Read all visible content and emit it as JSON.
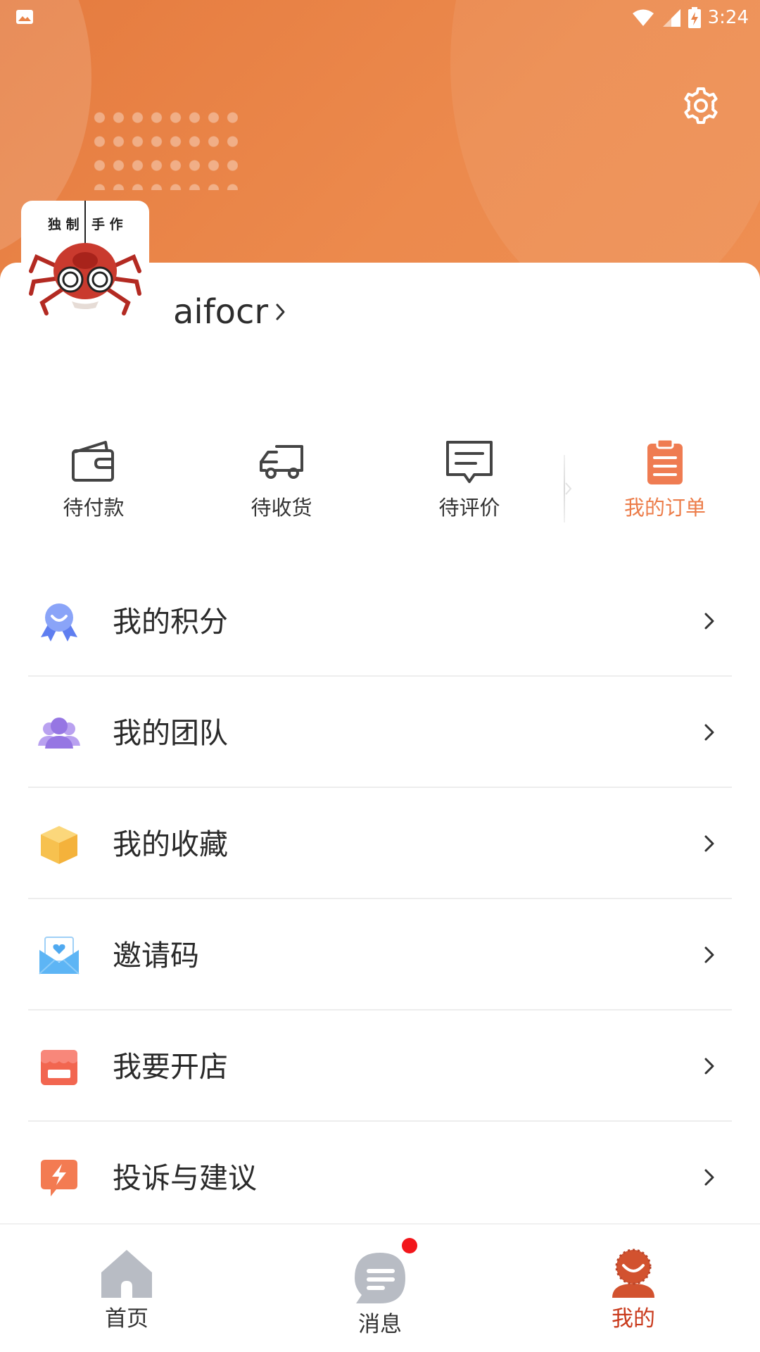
{
  "status_bar": {
    "time": "3:24",
    "icons": [
      "image-icon",
      "wifi-icon",
      "signal-icon",
      "battery-charging-icon"
    ]
  },
  "header": {
    "settings_icon": "gear-icon",
    "avatar_text": "独制手作",
    "avatar_colors": {
      "spider": "#c93a2e"
    }
  },
  "profile": {
    "username": "aifocr"
  },
  "orders": {
    "items": [
      {
        "label": "待付款",
        "icon": "wallet-icon"
      },
      {
        "label": "待收货",
        "icon": "truck-icon"
      },
      {
        "label": "待评价",
        "icon": "comment-icon"
      },
      {
        "label": "我的订单",
        "icon": "clipboard-icon"
      }
    ],
    "accent": "#ec7d4a"
  },
  "menu": {
    "items": [
      {
        "label": "我的积分",
        "icon": "medal-icon",
        "color": "#6f8df5"
      },
      {
        "label": "我的团队",
        "icon": "team-icon",
        "color": "#9b7be6"
      },
      {
        "label": "我的收藏",
        "icon": "box-icon",
        "color": "#f6c255"
      },
      {
        "label": "邀请码",
        "icon": "envelope-heart-icon",
        "color": "#5ab0f4"
      },
      {
        "label": "我要开店",
        "icon": "shop-icon",
        "color": "#f26650"
      },
      {
        "label": "投诉与建议",
        "icon": "lightning-bubble-icon",
        "color": "#f37b52"
      }
    ]
  },
  "bottom_nav": {
    "items": [
      {
        "label": "首页",
        "icon": "home-icon"
      },
      {
        "label": "消息",
        "icon": "message-icon",
        "badge": true
      },
      {
        "label": "我的",
        "icon": "profile-icon",
        "active": true
      }
    ],
    "active_color": "#c93a1c",
    "badge_color": "#f2161b"
  }
}
